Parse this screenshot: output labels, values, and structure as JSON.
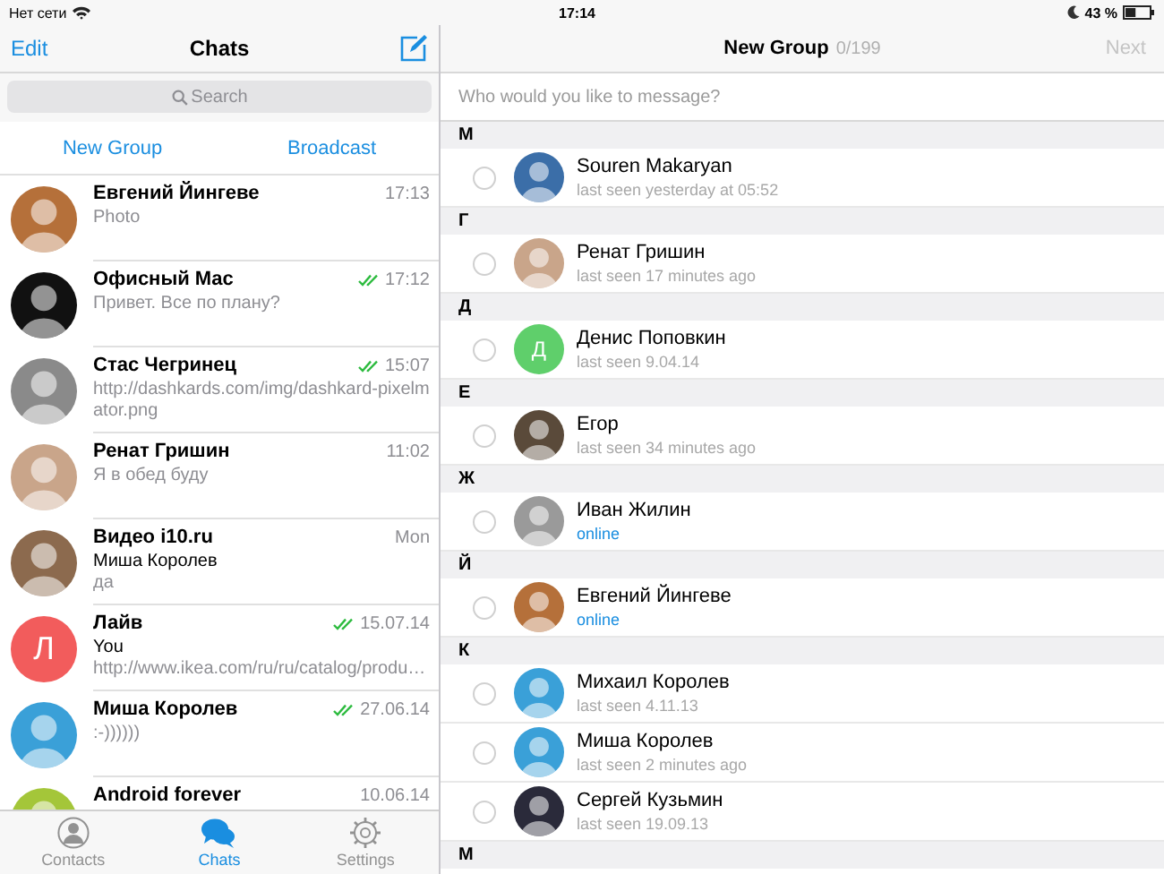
{
  "status_bar": {
    "carrier": "Нет сети",
    "time": "17:14",
    "battery_text": "43 %"
  },
  "chats_panel": {
    "edit": "Edit",
    "title": "Chats",
    "search": {
      "placeholder": "Search"
    },
    "actions": [
      "New Group",
      "Broadcast"
    ],
    "chats": [
      {
        "name": "Евгений Йингеве",
        "time": "17:13",
        "read": false,
        "preview": "Photo",
        "avatar": {
          "kind": "photo",
          "color": "#b5703a"
        }
      },
      {
        "name": "Офисный Mac",
        "time": "17:12",
        "read": true,
        "preview": "Привет. Все по плану?",
        "avatar": {
          "kind": "photo",
          "color": "#111111"
        }
      },
      {
        "name": "Стас Чегринец",
        "time": "15:07",
        "read": true,
        "preview": "http://dashkards.com/img/dashkard-pixelmator.png",
        "avatar": {
          "kind": "photo",
          "color": "#8a8a8a"
        }
      },
      {
        "name": "Ренат Гришин",
        "time": "11:02",
        "read": false,
        "preview": "Я в обед буду",
        "avatar": {
          "kind": "photo",
          "color": "#c9a58a"
        }
      },
      {
        "name": "Видео i10.ru",
        "time": "Mon",
        "read": false,
        "sender": "Миша Королев",
        "preview": "да",
        "avatar": {
          "kind": "photo",
          "color": "#8c6a4e"
        }
      },
      {
        "name": "Лайв",
        "time": "15.07.14",
        "read": true,
        "sender": "You",
        "preview": "http://www.ikea.com/ru/ru/catalog/produ…",
        "avatar": {
          "kind": "letter",
          "initial": "Л",
          "color": "#f25c5c"
        }
      },
      {
        "name": "Миша Королев",
        "time": "27.06.14",
        "read": true,
        "preview": ":-))))))",
        "avatar": {
          "kind": "photo",
          "color": "#3aa0d8"
        }
      },
      {
        "name": "Android forever",
        "time": "10.06.14",
        "read": false,
        "avatar": {
          "kind": "photo",
          "color": "#a4c639"
        }
      }
    ],
    "tabs": [
      {
        "label": "Contacts",
        "kind": "contacts",
        "selected": false
      },
      {
        "label": "Chats",
        "kind": "chats",
        "selected": true
      },
      {
        "label": "Settings",
        "kind": "settings",
        "selected": false
      }
    ]
  },
  "new_group": {
    "title": "New Group",
    "count": "0/199",
    "next": "Next",
    "prompt": {
      "placeholder": "Who would you like to message?"
    },
    "sections": [
      {
        "letter": "M",
        "contacts": [
          {
            "name": "Souren Makaryan",
            "status": "last seen yesterday at 05:52",
            "online": false,
            "checked": false,
            "avatar": {
              "kind": "photo",
              "color": "#3b6ea8"
            }
          }
        ]
      },
      {
        "letter": "Г",
        "contacts": [
          {
            "name": "Ренат Гришин",
            "status": "last seen 17 minutes ago",
            "online": false,
            "checked": false,
            "avatar": {
              "kind": "photo",
              "color": "#c9a58a"
            }
          }
        ]
      },
      {
        "letter": "Д",
        "contacts": [
          {
            "name": "Денис Поповкин",
            "status": "last seen 9.04.14",
            "online": false,
            "checked": false,
            "avatar": {
              "kind": "letter",
              "initial": "Д",
              "color": "#5fcf6b"
            }
          }
        ]
      },
      {
        "letter": "Е",
        "contacts": [
          {
            "name": "Егор",
            "status": "last seen 34 minutes ago",
            "online": false,
            "checked": false,
            "avatar": {
              "kind": "photo",
              "color": "#5a4a3a"
            }
          }
        ]
      },
      {
        "letter": "Ж",
        "contacts": [
          {
            "name": "Иван Жилин",
            "status": "online",
            "online": true,
            "checked": false,
            "avatar": {
              "kind": "photo",
              "color": "#9a9a9a"
            }
          }
        ]
      },
      {
        "letter": "Й",
        "contacts": [
          {
            "name": "Евгений Йингеве",
            "status": "online",
            "online": true,
            "checked": false,
            "avatar": {
              "kind": "photo",
              "color": "#b5703a"
            }
          }
        ]
      },
      {
        "letter": "К",
        "contacts": [
          {
            "name": "Михаил Королев",
            "status": "last seen 4.11.13",
            "online": false,
            "checked": false,
            "avatar": {
              "kind": "photo",
              "color": "#3aa0d8"
            }
          },
          {
            "name": "Миша Королев",
            "status": "last seen 2 minutes ago",
            "online": false,
            "checked": false,
            "avatar": {
              "kind": "photo",
              "color": "#3aa0d8"
            }
          },
          {
            "name": "Сергей Кузьмин",
            "status": "last seen 19.09.13",
            "online": false,
            "checked": false,
            "avatar": {
              "kind": "photo",
              "color": "#2a2a3a"
            }
          }
        ]
      },
      {
        "letter": "М"
      }
    ]
  }
}
